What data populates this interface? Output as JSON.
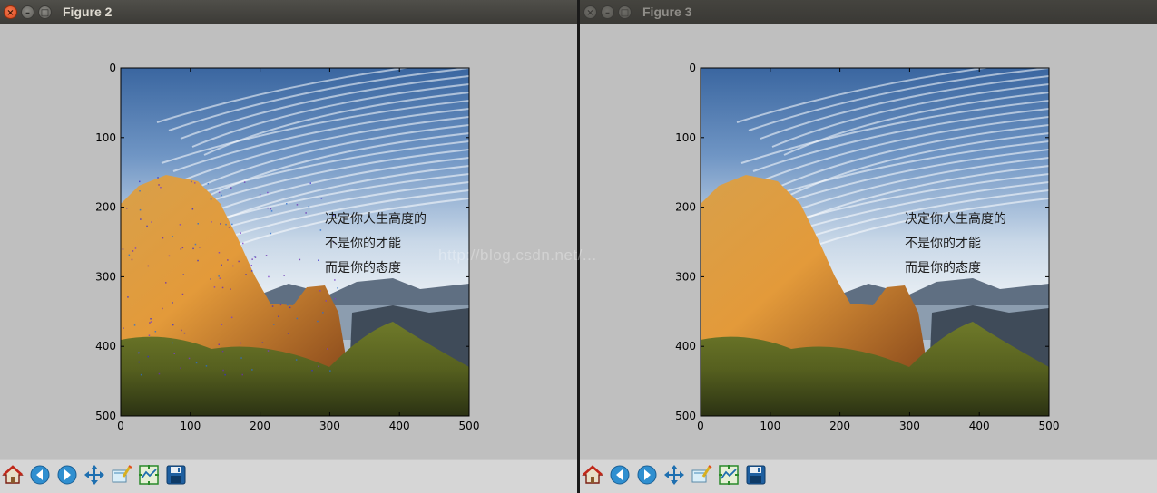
{
  "windows": [
    {
      "title": "Figure 2",
      "active": true,
      "axis": {
        "xlim": [
          0,
          500
        ],
        "ylim": [
          500,
          0
        ],
        "xticks": [
          "0",
          "100",
          "200",
          "300",
          "400",
          "500"
        ],
        "yticks": [
          "0",
          "100",
          "200",
          "300",
          "400",
          "500"
        ]
      },
      "image_caption": [
        "决定你人生高度的",
        "不是你的才能",
        "而是你的态度"
      ],
      "image_noise": true
    },
    {
      "title": "Figure 3",
      "active": false,
      "axis": {
        "xlim": [
          0,
          500
        ],
        "ylim": [
          500,
          0
        ],
        "xticks": [
          "0",
          "100",
          "200",
          "300",
          "400",
          "500"
        ],
        "yticks": [
          "0",
          "100",
          "200",
          "300",
          "400",
          "500"
        ]
      },
      "image_caption": [
        "决定你人生高度的",
        "不是你的才能",
        "而是你的态度"
      ],
      "image_noise": false
    }
  ],
  "toolbar_icons": [
    "home-icon",
    "back-arrow-icon",
    "forward-arrow-icon",
    "pan-icon",
    "zoom-icon",
    "configure-subplots-icon",
    "save-icon"
  ],
  "colors": {
    "figure_bg": "#bfbfbf",
    "toolbar_bg": "#d6d6d6",
    "titlebar_bg": "#3c3b37"
  }
}
